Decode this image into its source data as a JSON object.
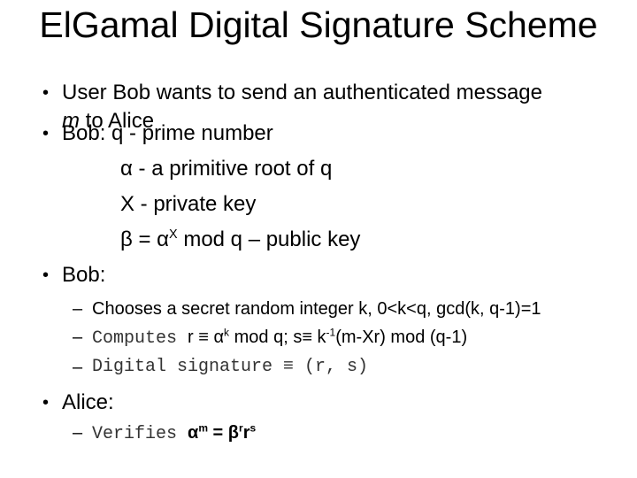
{
  "title": "ElGamal Digital Signature Scheme",
  "bullet_symbol": "•",
  "dash_symbol": "–",
  "b1": {
    "line1": "User Bob wants to send an authenticated message",
    "m": "m",
    "line2_rest": " to Alice"
  },
  "b2": {
    "label": "Bob: q - prime number",
    "alpha": "α",
    "alpha_rest": " - a primitive root of q",
    "x_line": "X - private key",
    "beta": "β",
    "eq": " = ",
    "alpha2": "α",
    "sup_x": "X",
    "beta_rest": " mod q – public key"
  },
  "b3": {
    "label": "Bob:",
    "s1": "Chooses a secret random integer k, 0<k<q, gcd(k, q-1)=1",
    "s2_mono": "Computes ",
    "s2_r": "r ≡ α",
    "s2_sup_k": "k",
    "s2_mid": " mod q;  ",
    "s2_s": "s",
    "s2_s_rest": "≡ k",
    "s2_sup": "-1",
    "s2_end": "(m-Xr) mod (q-1)",
    "s3": "Digital signature ≡ (r, s)"
  },
  "b4": {
    "label": "Alice:",
    "s1_mono": "Verifies ",
    "am": "α",
    "am_sup": "m",
    "eq": " = ",
    "b": "β",
    "b_sup": "r",
    "r": "r",
    "r_sup": "s"
  }
}
